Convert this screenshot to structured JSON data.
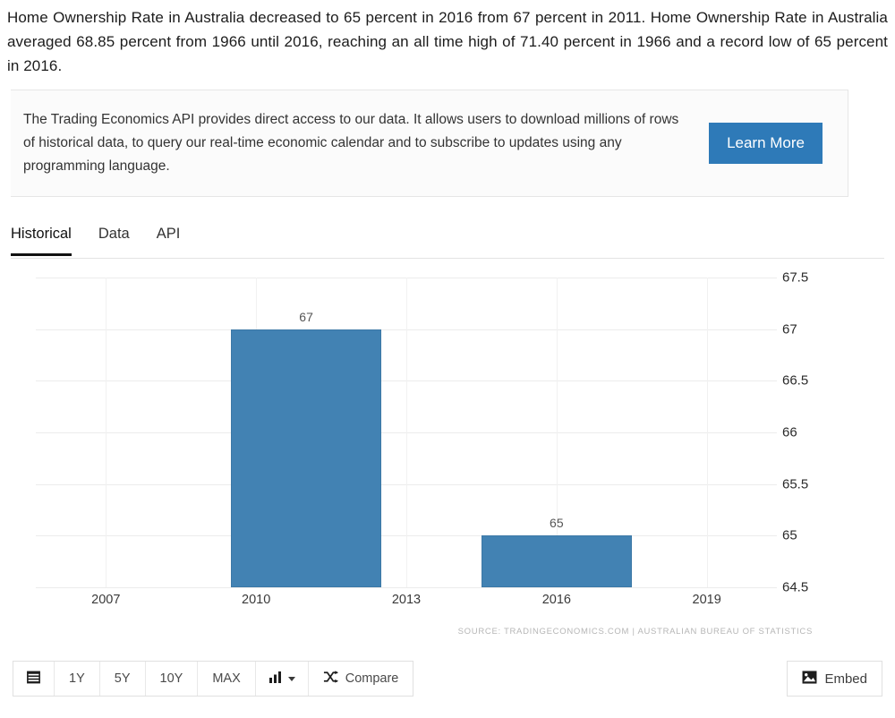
{
  "intro": {
    "text": "Home Ownership Rate in Australia decreased to 65 percent in 2016 from 67 percent in 2011. Home Ownership Rate in Australia averaged 68.85 percent from 1966 until 2016, reaching an all time high of 71.40 percent in 1966 and a record low of 65 percent in 2016."
  },
  "banner": {
    "text": "The Trading Economics API provides direct access to our data. It allows users to download millions of rows of historical data, to query our real-time economic calendar and to subscribe to updates using any programming language.",
    "button_label": "Learn More",
    "button_color": "#2e7ab8"
  },
  "tabs": [
    {
      "label": "Historical",
      "active": true
    },
    {
      "label": "Data",
      "active": false
    },
    {
      "label": "API",
      "active": false
    }
  ],
  "chart_data": {
    "type": "bar",
    "title": "",
    "xlabel": "",
    "ylabel": "",
    "categories": [
      "2011",
      "2016"
    ],
    "values": [
      67,
      65
    ],
    "x": [
      2011,
      2016
    ],
    "bar_color": "#4282b3",
    "ylim": [
      64.5,
      67.5
    ],
    "yticks": [
      "67.5",
      "67",
      "66.5",
      "66",
      "65.5",
      "65",
      "64.5"
    ],
    "ytick_values": [
      67.5,
      67,
      66.5,
      66,
      65.5,
      65,
      64.5
    ],
    "xticks": [
      "2007",
      "2010",
      "2013",
      "2016",
      "2019"
    ],
    "xtick_values": [
      2007,
      2010,
      2013,
      2016,
      2019
    ],
    "xlim": [
      2005.6,
      2020.4
    ],
    "data_labels": [
      "67",
      "65"
    ],
    "grid": true,
    "legend": false,
    "source": "SOURCE: TRADINGECONOMICS.COM  |  AUSTRALIAN BUREAU OF STATISTICS"
  },
  "toolbar": {
    "calendar_icon": "calendar-icon",
    "ranges": [
      "1Y",
      "5Y",
      "10Y",
      "MAX"
    ],
    "chart_type_icon": "bar-chart-icon",
    "compare_icon": "shuffle-icon",
    "compare_label": "Compare",
    "embed_icon": "image-icon",
    "embed_label": "Embed"
  }
}
